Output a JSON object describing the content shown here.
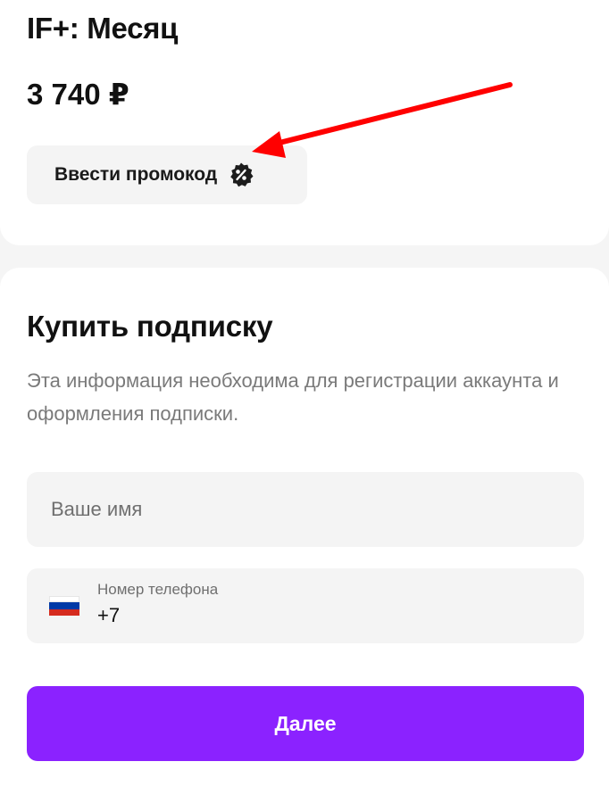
{
  "plan": {
    "title": "IF+: Месяц",
    "price": "3 740 ₽"
  },
  "promo": {
    "label": "Ввести промокод",
    "icon": "percent-badge-icon"
  },
  "annotation": {
    "icon": "red-arrow-icon",
    "color": "#ff0000"
  },
  "buy": {
    "title": "Купить подписку",
    "description": "Эта информация необходима для регистрации аккаунта и оформления подписки."
  },
  "form": {
    "name_placeholder": "Ваше имя",
    "phone_label": "Номер телефона",
    "phone_value": "+7",
    "country_flag": "russia-flag-icon",
    "flag_colors": [
      "#ffffff",
      "#0039a6",
      "#d52b1e"
    ]
  },
  "next_button": {
    "label": "Далее",
    "color": "#8b22ff"
  }
}
